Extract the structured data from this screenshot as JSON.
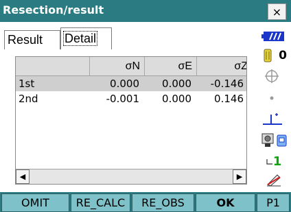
{
  "window": {
    "title": "Resection/result",
    "close_label": "×"
  },
  "tabs": [
    {
      "label": "Result"
    },
    {
      "label": "Detail"
    }
  ],
  "table": {
    "columns": [
      "",
      "σN",
      "σE",
      "σZ"
    ],
    "rows": [
      {
        "label": "1st",
        "n": "0.000",
        "e": "0.000",
        "z": "-0.146"
      },
      {
        "label": "2nd",
        "n": "-0.001",
        "e": "0.000",
        "z": "0.146"
      }
    ],
    "scroll_left": "◀",
    "scroll_right": "▶"
  },
  "status": {
    "memory_count": "0",
    "page_digit": "1"
  },
  "softkeys": [
    {
      "label": "OMIT"
    },
    {
      "label": "RE_CALC"
    },
    {
      "label": "RE_OBS"
    },
    {
      "label": "OK"
    },
    {
      "label": "P1"
    }
  ],
  "colors": {
    "titlebar": "#2a7c82",
    "softkey": "#7ec1c8",
    "selected_row": "#cfcfcf",
    "battery": "#1a35c9"
  }
}
